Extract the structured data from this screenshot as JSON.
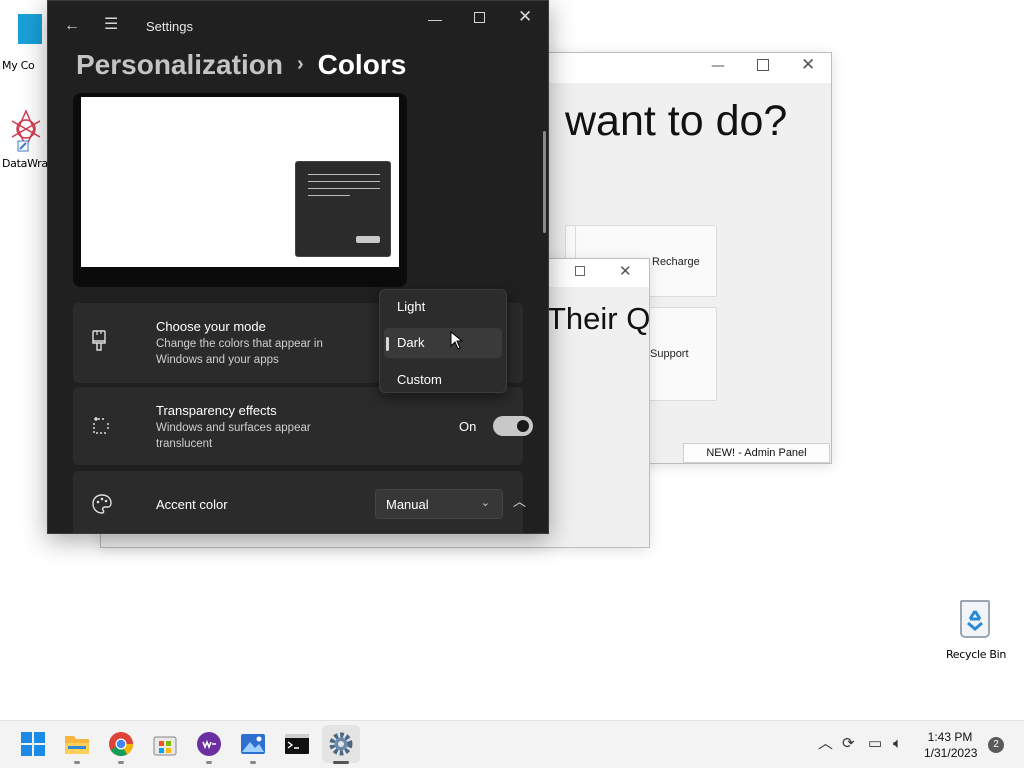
{
  "desktop": {
    "icons": [
      {
        "label": "My Co",
        "icon": "computer-icon"
      },
      {
        "label": "DataWra",
        "icon": "datawrapper-icon"
      },
      {
        "label": "Recycle Bin",
        "icon": "recycle-bin-icon"
      }
    ]
  },
  "bg_window_a": {
    "heading": "want to do?",
    "tiles": [
      "Recharge",
      "Support"
    ],
    "admin_button": "NEW! - Admin Panel"
  },
  "bg_window_b": {
    "heading": "Their Q"
  },
  "settings": {
    "title": "Settings",
    "breadcrumb": {
      "parent": "Personalization",
      "separator": "›",
      "current": "Colors"
    },
    "mode": {
      "title": "Choose your mode",
      "description": "Change the colors that appear in Windows and your apps",
      "options": [
        "Light",
        "Dark",
        "Custom"
      ],
      "selected": "Dark"
    },
    "transparency": {
      "title": "Transparency effects",
      "description": "Windows and surfaces appear translucent",
      "state_label": "On",
      "enabled": true
    },
    "accent": {
      "title": "Accent color",
      "value": "Manual"
    }
  },
  "taskbar": {
    "apps": [
      "start-icon",
      "file-explorer-icon",
      "chrome-icon",
      "store-icon",
      "webex-icon",
      "photos-icon",
      "terminal-icon",
      "settings-icon"
    ],
    "time": "1:43 PM",
    "date": "1/31/2023",
    "notification_count": "2"
  },
  "colors": {
    "settings_bg": "#202020",
    "card_bg": "#2b2b2b",
    "desktop_bg": "#ffffff",
    "taskbar_bg": "#f3f3f3"
  }
}
